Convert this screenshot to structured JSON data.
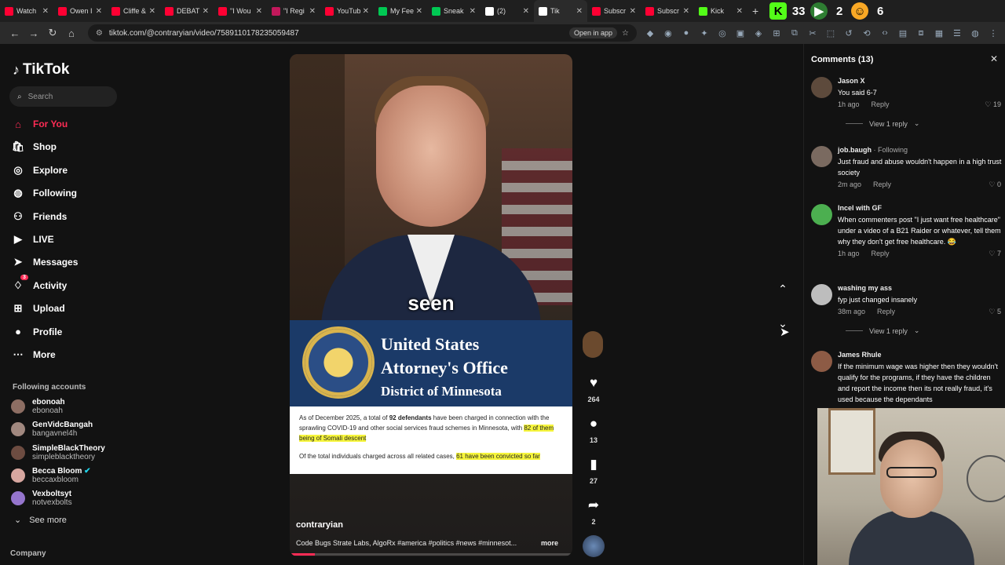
{
  "browser": {
    "tabs": [
      {
        "label": "Watch",
        "color": "#ff0033"
      },
      {
        "label": "Owen I",
        "color": "#ff0033"
      },
      {
        "label": "Cliffe &",
        "color": "#ff0033"
      },
      {
        "label": "DEBATI",
        "color": "#ff0033"
      },
      {
        "label": "\"I Wou",
        "color": "#ff0033"
      },
      {
        "label": "\"I Regi",
        "color": "#c2185b"
      },
      {
        "label": "YouTub",
        "color": "#ff0033"
      },
      {
        "label": "My Fee",
        "color": "#00c853"
      },
      {
        "label": "Sneak",
        "color": "#00c853"
      },
      {
        "label": "(2)",
        "color": "#ffffff"
      },
      {
        "label": "Tik",
        "color": "#ffffff",
        "active": true
      },
      {
        "label": "Subscr",
        "color": "#ff0033"
      },
      {
        "label": "Subscr",
        "color": "#ff0033"
      },
      {
        "label": "Kick",
        "color": "#53fc18"
      }
    ],
    "extensions": {
      "badge1": "33",
      "badge2": "2",
      "badge3": "6"
    },
    "url": "tiktok.com/@contraryian/video/7589110178235059487",
    "open_in_app": "Open in app"
  },
  "sidebar": {
    "logo": "TikTok",
    "search_placeholder": "Search",
    "items": [
      {
        "label": "For You",
        "icon": "home-icon"
      },
      {
        "label": "Shop",
        "icon": "shop-icon"
      },
      {
        "label": "Explore",
        "icon": "compass-icon"
      },
      {
        "label": "Following",
        "icon": "following-avatar-icon"
      },
      {
        "label": "Friends",
        "icon": "friends-icon"
      },
      {
        "label": "LIVE",
        "icon": "live-icon"
      },
      {
        "label": "Messages",
        "icon": "send-icon"
      },
      {
        "label": "Activity",
        "icon": "bell-icon",
        "badge": "3"
      },
      {
        "label": "Upload",
        "icon": "upload-icon"
      },
      {
        "label": "Profile",
        "icon": "profile-avatar-icon"
      },
      {
        "label": "More",
        "icon": "more-icon"
      }
    ],
    "following_title": "Following accounts",
    "following": [
      {
        "name": "ebonoah",
        "handle": "ebonoah"
      },
      {
        "name": "GenVidcBangah",
        "handle": "bangavnel4h"
      },
      {
        "name": "SimpleBlackTheory",
        "handle": "simpleblacktheory"
      },
      {
        "name": "Becca Bloom",
        "handle": "beccaxbloom",
        "verified": true
      },
      {
        "name": "Vexboltsyt",
        "handle": "notvexbolts"
      }
    ],
    "see_more": "See more",
    "company": "Company"
  },
  "video": {
    "caption_word": "seen",
    "doj_line1": "United States",
    "doj_line2": "Attorney's Office",
    "doj_line3": "District of Minnesota",
    "para1_a": "As of December 2025, a total of ",
    "para1_b": "92 defendants",
    "para1_c": " have been charged in connection with the sprawling COVID-19 and other social services fraud schemes in Minnesota, with ",
    "para1_d": "82 of them being of Somali descent",
    "para2_a": "Of the total individuals charged across all related cases, ",
    "para2_b": "61 have been convicted so far",
    "username": "contraryian",
    "description": "Code Bugs Strate Labs, AlgoRx #america #politics #news #minnesot...",
    "more": "more",
    "progress": 0.09
  },
  "actions": {
    "likes": "264",
    "comments": "13",
    "saves": "27",
    "shares": "2"
  },
  "comments": {
    "header": "Comments (13)",
    "items": [
      {
        "name": "Jason X",
        "tag": "",
        "text": "You said 6-7",
        "time": "1h ago",
        "reply": "Reply",
        "likes": "19",
        "view_reply": "View 1 reply",
        "avatar": "#5d4a3c"
      },
      {
        "name": "job.baugh",
        "tag": " · Following",
        "text": "Just fraud and abuse wouldn't happen in a high trust society",
        "time": "2m ago",
        "reply": "Reply",
        "likes": "0",
        "avatar": "#7a6a60"
      },
      {
        "name": "Incel with GF",
        "tag": "",
        "text": "When commenters post \"I just want free healthcare\" under a video of a B21 Raider or whatever, tell them why they don't get free healthcare. 😂",
        "time": "1h ago",
        "reply": "Reply",
        "likes": "7",
        "avatar": "#4caf50"
      },
      {
        "name": "washing my ass",
        "tag": "",
        "text": "fyp just changed insanely",
        "time": "38m ago",
        "reply": "Reply",
        "likes": "5",
        "view_reply": "View 1 reply",
        "avatar": "#bdbdbd"
      },
      {
        "name": "James Rhule",
        "tag": "",
        "text": "If the minimum wage was higher then they wouldn't qualify for the programs, if they have the children and report the income then its not really fraud, it's used because the dependants",
        "avatar": "#8d5b45"
      }
    ]
  }
}
